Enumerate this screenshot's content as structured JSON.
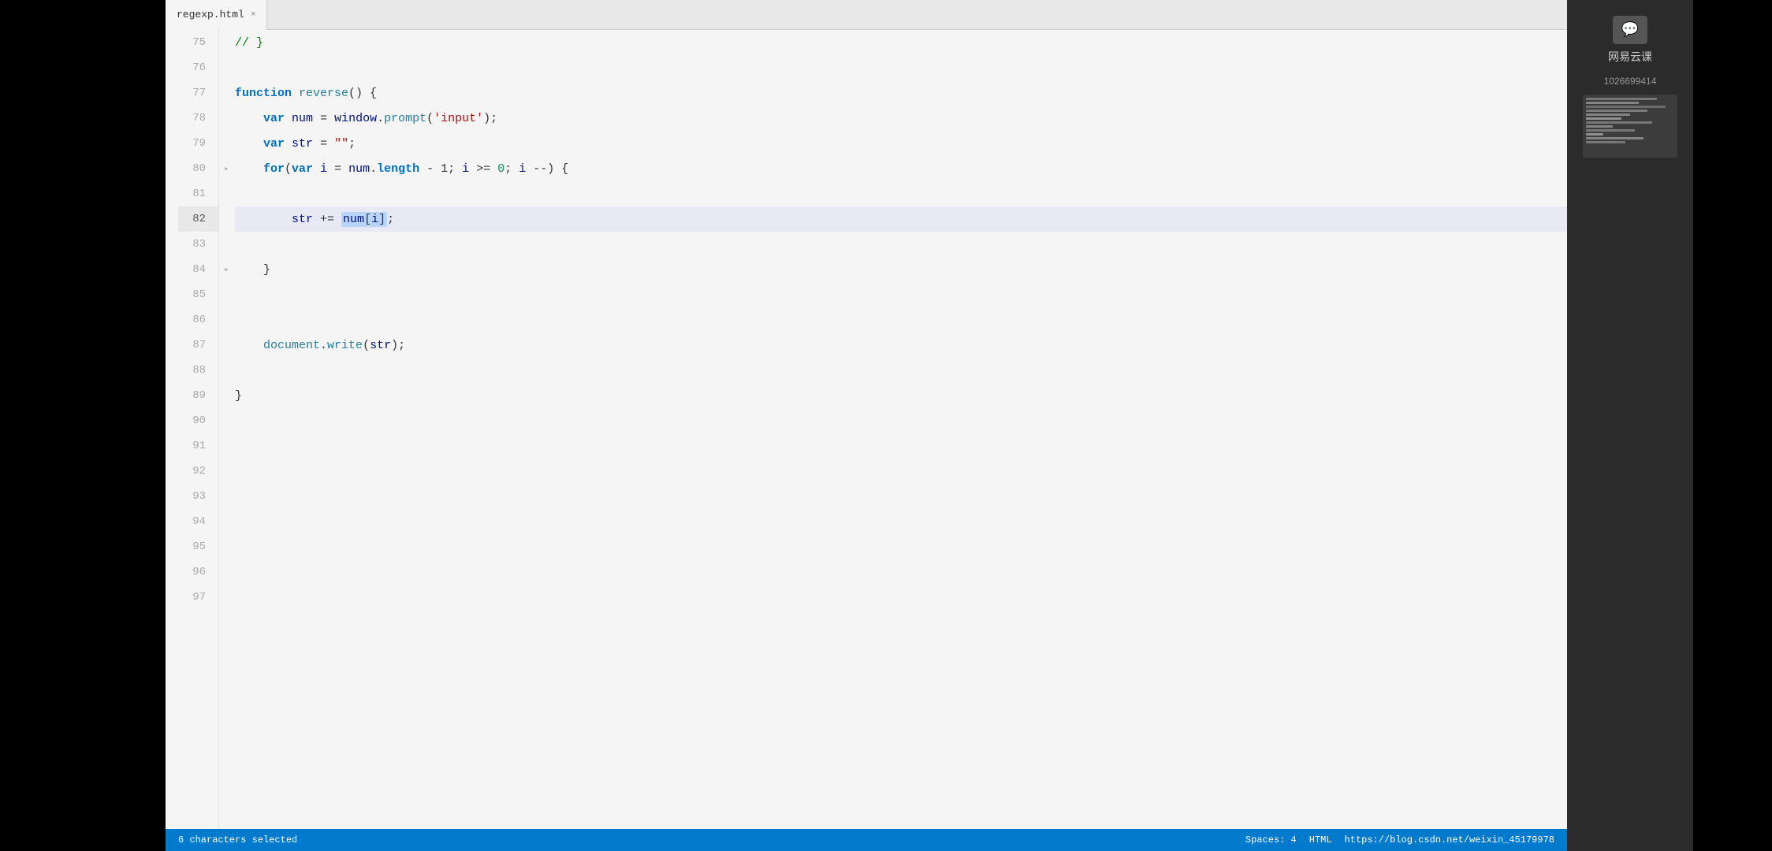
{
  "tab": {
    "filename": "regexp.html",
    "close_label": "×"
  },
  "editor": {
    "lines": [
      {
        "num": 75,
        "content": "// }",
        "type": "comment",
        "active": false
      },
      {
        "num": 76,
        "content": "",
        "type": "empty",
        "active": false
      },
      {
        "num": 77,
        "content": "FUNCTION_LINE",
        "type": "function_decl",
        "active": false
      },
      {
        "num": 78,
        "content": "VAR_NUM_LINE",
        "type": "var_num",
        "active": false
      },
      {
        "num": 79,
        "content": "VAR_STR_LINE",
        "type": "var_str",
        "active": false
      },
      {
        "num": 80,
        "content": "FOR_LINE",
        "type": "for_loop",
        "active": false,
        "fold": true
      },
      {
        "num": 81,
        "content": "",
        "type": "empty",
        "active": false
      },
      {
        "num": 82,
        "content": "STR_ASSIGN_LINE",
        "type": "str_assign",
        "active": true
      },
      {
        "num": 83,
        "content": "",
        "type": "empty",
        "active": false
      },
      {
        "num": 84,
        "content": "CLOSE_BRACE",
        "type": "close_brace_for",
        "active": false,
        "fold": true
      },
      {
        "num": 85,
        "content": "",
        "type": "empty",
        "active": false
      },
      {
        "num": 86,
        "content": "",
        "type": "empty",
        "active": false
      },
      {
        "num": 87,
        "content": "DOC_WRITE_LINE",
        "type": "doc_write",
        "active": false
      },
      {
        "num": 88,
        "content": "",
        "type": "empty",
        "active": false
      },
      {
        "num": 89,
        "content": "CLOSE_BRACE_FN",
        "type": "close_brace_fn",
        "active": false
      },
      {
        "num": 90,
        "content": "",
        "type": "empty",
        "active": false
      },
      {
        "num": 91,
        "content": "",
        "type": "empty",
        "active": false
      },
      {
        "num": 92,
        "content": "",
        "type": "empty",
        "active": false
      },
      {
        "num": 93,
        "content": "",
        "type": "empty",
        "active": false
      },
      {
        "num": 94,
        "content": "",
        "type": "empty",
        "active": false
      },
      {
        "num": 95,
        "content": "",
        "type": "empty",
        "active": false
      },
      {
        "num": 96,
        "content": "",
        "type": "empty",
        "active": false
      },
      {
        "num": 97,
        "content": "",
        "type": "empty",
        "active": false
      }
    ]
  },
  "status_bar": {
    "selection_info": "6 characters selected",
    "spaces": "Spaces: 4",
    "file_type": "HTML",
    "url": "https://blog.csdn.net/weixin_45179978"
  },
  "right_panel": {
    "brand": "网易云课",
    "user_id": "1026699414",
    "chat_icon": "💬"
  },
  "colors": {
    "keyword": "#0070c1",
    "function_name": "#267f99",
    "string": "#a31515",
    "number": "#098658",
    "variable": "#001080",
    "property": "#0070c1",
    "comment": "#008000",
    "plain": "#333333",
    "highlight": "#b8d6fd",
    "active_line_bg": "rgba(100,100,255,0.06)",
    "status_bar": "#007acc",
    "tab_bg": "#f5f5f5",
    "editor_bg": "#f5f5f5"
  }
}
